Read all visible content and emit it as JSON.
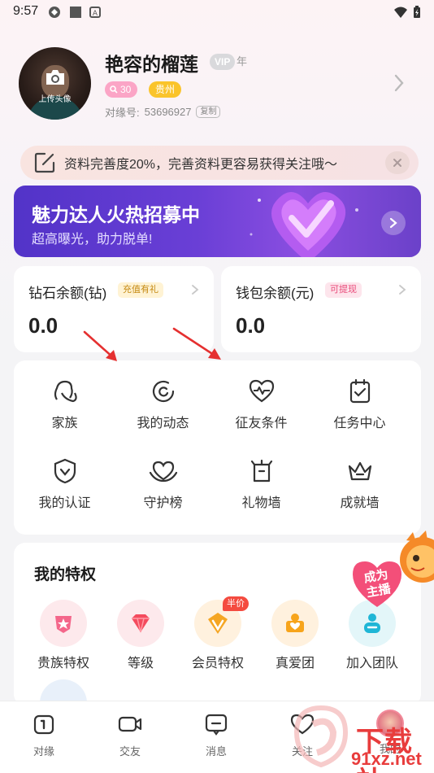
{
  "status_bar": {
    "time": "9:57"
  },
  "profile": {
    "avatar_label": "上传头像",
    "username": "艳容的榴莲",
    "vip_badge": "VIP",
    "vip_suffix": "年",
    "age": "30",
    "location": "贵州",
    "id_label": "对缘号:",
    "id_value": "53696927",
    "copy_label": "复制"
  },
  "completeness_banner": {
    "text": "资料完善度20%，完善资料更容易获得关注哦～"
  },
  "promo": {
    "title": "魅力达人火热招募中",
    "subtitle": "超高曝光，助力脱单!"
  },
  "balances": [
    {
      "label": "钻石余额(钻)",
      "tag": "充值有礼",
      "value": "0.0"
    },
    {
      "label": "钱包余额(元)",
      "tag": "可提现",
      "value": "0.0"
    }
  ],
  "grid": [
    {
      "label": "家族",
      "icon": "family-icon"
    },
    {
      "label": "我的动态",
      "icon": "moments-icon"
    },
    {
      "label": "征友条件",
      "icon": "heart-pulse-icon"
    },
    {
      "label": "任务中心",
      "icon": "task-icon"
    },
    {
      "label": "我的认证",
      "icon": "shield-check-icon"
    },
    {
      "label": "守护榜",
      "icon": "guard-heart-icon"
    },
    {
      "label": "礼物墙",
      "icon": "gift-wall-icon"
    },
    {
      "label": "成就墙",
      "icon": "crown-icon"
    }
  ],
  "privileges": {
    "title": "我的特权",
    "items": [
      {
        "label": "贵族特权",
        "icon": "noble-icon"
      },
      {
        "label": "等级",
        "icon": "level-gem-icon"
      },
      {
        "label": "会员特权",
        "icon": "vip-icon",
        "badge": "半价"
      },
      {
        "label": "真爱团",
        "icon": "love-group-icon"
      },
      {
        "label": "加入团队",
        "icon": "team-icon"
      }
    ],
    "become_host": "成为主播"
  },
  "bottom_nav": [
    {
      "label": "对缘",
      "icon": "home-icon"
    },
    {
      "label": "交友",
      "icon": "video-icon"
    },
    {
      "label": "消息",
      "icon": "message-icon"
    },
    {
      "label": "关注",
      "icon": "heart-icon"
    },
    {
      "label": "我的",
      "icon": "profile-avatar-icon"
    }
  ],
  "watermark": {
    "line1": "下载站",
    "line2": "91xz.net"
  },
  "colors": {
    "promo_purple": "#5a38cc",
    "tag_yellow": "#fac42b",
    "tag_pink": "#fba5c6",
    "accent_red": "#f44b3f"
  }
}
